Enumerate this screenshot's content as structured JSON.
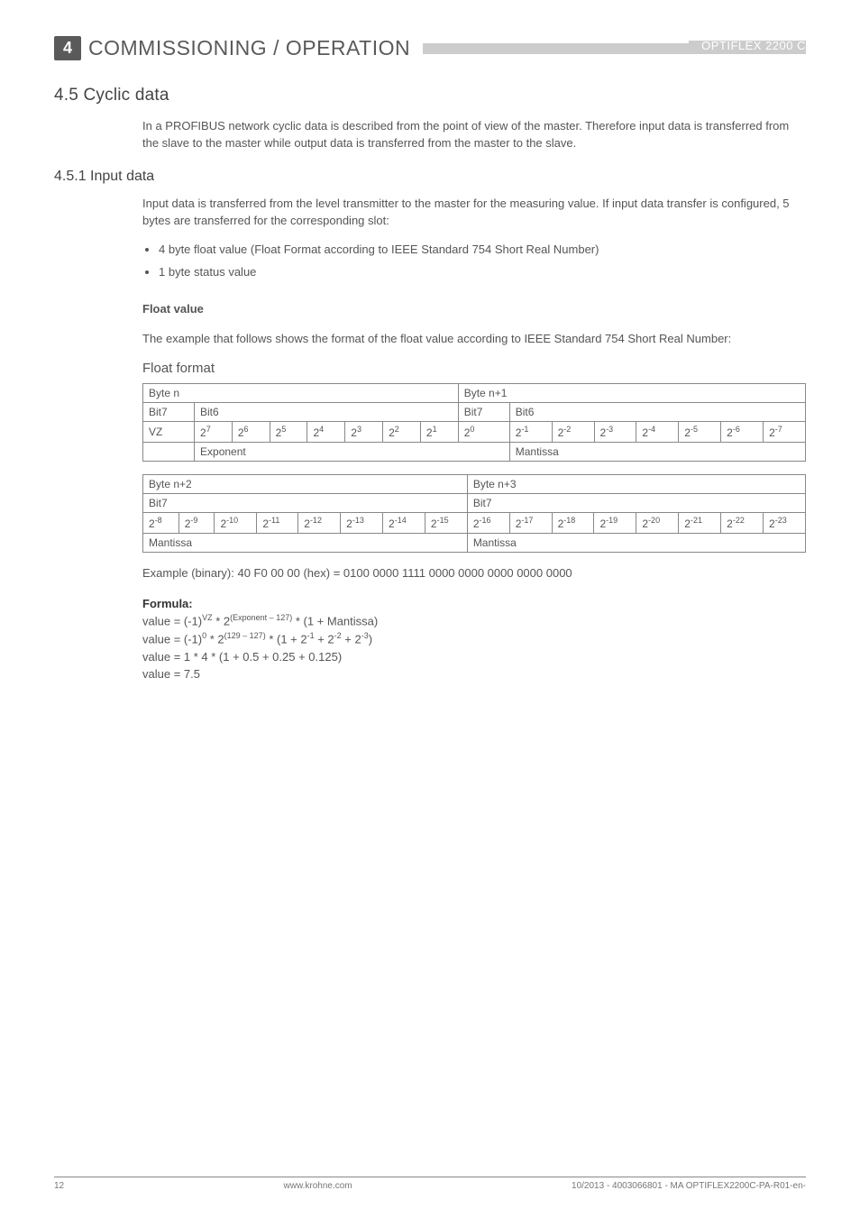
{
  "header": {
    "chip": "4",
    "title": "COMMISSIONING / OPERATION",
    "product": "OPTIFLEX 2200 C"
  },
  "s45": {
    "title": "4.5  Cyclic data",
    "p1": "In a PROFIBUS network cyclic data is described from the point of view of the master. Therefore input data is transferred from the slave to the master while output data is transferred from the master to the slave."
  },
  "s451": {
    "title": "4.5.1  Input data",
    "p1": "Input data is transferred from the level transmitter to the master for the measuring value. If input data transfer is configured, 5 bytes are transferred for the corresponding slot:",
    "b1": "4  byte float value (Float Format according to IEEE Standard 754 Short Real Number)",
    "b2": "1 byte status value",
    "fv_h": "Float value",
    "fv_p": "The example that follows shows the format of the float value according to IEEE Standard 754 Short Real Number:",
    "ff_h": "Float format",
    "t1": {
      "r1c1": "Byte n",
      "r1c2": "Byte n+1",
      "r2c1": "Bit7",
      "r2c2": "Bit6",
      "r2c3": "Bit7",
      "r2c4": "Bit6",
      "vz": "VZ",
      "e7": "7",
      "e6": "6",
      "e5": "5",
      "e4": "4",
      "e3": "3",
      "e2": "2",
      "e1": "1",
      "e0": "0",
      "m1": "-1",
      "m2": "-2",
      "m3": "-3",
      "m4": "-4",
      "m5": "-5",
      "m6": "-6",
      "m7": "-7",
      "exp": "Exponent",
      "man": "Mantissa"
    },
    "t2": {
      "r1c1": "Byte n+2",
      "r1c2": "Byte n+3",
      "bit7a": "Bit7",
      "bit7b": "Bit7",
      "m8": "-8",
      "m9": "-9",
      "m10": "-10",
      "m11": "-11",
      "m12": "-12",
      "m13": "-13",
      "m14": "-14",
      "m15": "-15",
      "m16": "-16",
      "m17": "-17",
      "m18": "-18",
      "m19": "-19",
      "m20": "-20",
      "m21": "-21",
      "m22": "-22",
      "m23": "-23",
      "mana": "Mantissa",
      "manb": "Mantissa"
    },
    "ex": "Example (binary): 40 F0 00 00 (hex) = 0100 0000 1111 0000 0000 0000 0000 0000",
    "formula_h": "Formula:",
    "f1a": "value = (-1)",
    "f1b": " * 2",
    "f1c": " * (1 + Mantissa)",
    "f1sup1": "VZ",
    "f1sup2": "(Exponent – 127)",
    "f2a": "value = (-1)",
    "f2b": "   * 2",
    "f2c": " * (1 + 2",
    "f2d": " + 2",
    "f2e": " + 2",
    "f2f": ")",
    "f2s1": "0",
    "f2s2": "(129 – 127)",
    "f2s3": "-1",
    "f2s4": "-2",
    "f2s5": "-3",
    "f3": "value = 1 * 4 * (1 + 0.5 + 0.25 + 0.125)",
    "f4": "value = 7.5"
  },
  "footer": {
    "page": "12",
    "url": "www.krohne.com",
    "doc": "10/2013 - 4003066801 - MA OPTIFLEX2200C-PA-R01-en-"
  }
}
